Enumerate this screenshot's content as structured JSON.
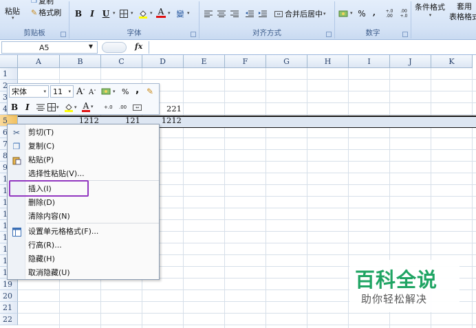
{
  "ribbon": {
    "clipboard": {
      "paste_label": "粘贴",
      "copy_label": "复制",
      "format_painter_label": "格式刷",
      "group_label": "剪贴板"
    },
    "font": {
      "bold": "B",
      "italic": "I",
      "underline": "U",
      "border_icon": "border-icon",
      "fill_icon": "fill-color-icon",
      "font_color_icon": "font-color-icon",
      "font_color_letter": "A",
      "phonetic": "變",
      "group_label": "字体"
    },
    "alignment": {
      "merge_center_label": "合并后居中",
      "group_label": "对齐方式"
    },
    "number": {
      "percent": "%",
      "comma": ",",
      "inc_decimal": "+.0 .00",
      "dec_decimal": ".00 +.0",
      "group_label": "数字"
    },
    "styles": {
      "conditional_format_label": "条件格式",
      "table_format_line1": "套用",
      "table_format_line2": "表格格式"
    }
  },
  "formula_bar": {
    "name_box_value": "A5",
    "fx_label": "fx",
    "formula_value": ""
  },
  "sheet": {
    "columns": [
      "A",
      "B",
      "C",
      "D",
      "E",
      "F",
      "G",
      "H",
      "I",
      "J",
      "K"
    ],
    "rows": [
      "1",
      "2",
      "3",
      "4",
      "5",
      "6",
      "7",
      "8",
      "9",
      "10",
      "11",
      "12",
      "13",
      "14",
      "15",
      "16",
      "17",
      "18",
      "19",
      "20",
      "21",
      "22"
    ],
    "cells": {
      "D4": "221",
      "B5": "1212",
      "C5": "121",
      "D5": "1212"
    },
    "selected_row": "5"
  },
  "mini_toolbar": {
    "font_name": "宋体",
    "font_size": "11",
    "grow_font": "A",
    "shrink_font": "A",
    "percent": "%",
    "comma": ",",
    "bold": "B",
    "italic": "I",
    "font_color_letter": "A",
    "inc_decimal": "+.0",
    "dec_decimal": ".00"
  },
  "context_menu": {
    "items": [
      {
        "label": "剪切(T)",
        "icon": "scissors-icon"
      },
      {
        "label": "复制(C)",
        "icon": "copy-icon"
      },
      {
        "label": "粘贴(P)",
        "icon": "paste-icon"
      },
      {
        "label": "选择性粘贴(V)...",
        "icon": ""
      },
      {
        "label": "插入(I)",
        "icon": ""
      },
      {
        "label": "删除(D)",
        "icon": ""
      },
      {
        "label": "清除内容(N)",
        "icon": ""
      },
      {
        "label": "设置单元格格式(F)...",
        "icon": "format-cells-icon"
      },
      {
        "label": "行高(R)...",
        "icon": ""
      },
      {
        "label": "隐藏(H)",
        "icon": ""
      },
      {
        "label": "取消隐藏(U)",
        "icon": ""
      }
    ],
    "highlighted_item": "插入(I)",
    "highlight_color": "#9136c0"
  },
  "watermark": {
    "title": "百科全说",
    "subtitle": "助你轻松解决",
    "color": "#1fa463"
  }
}
